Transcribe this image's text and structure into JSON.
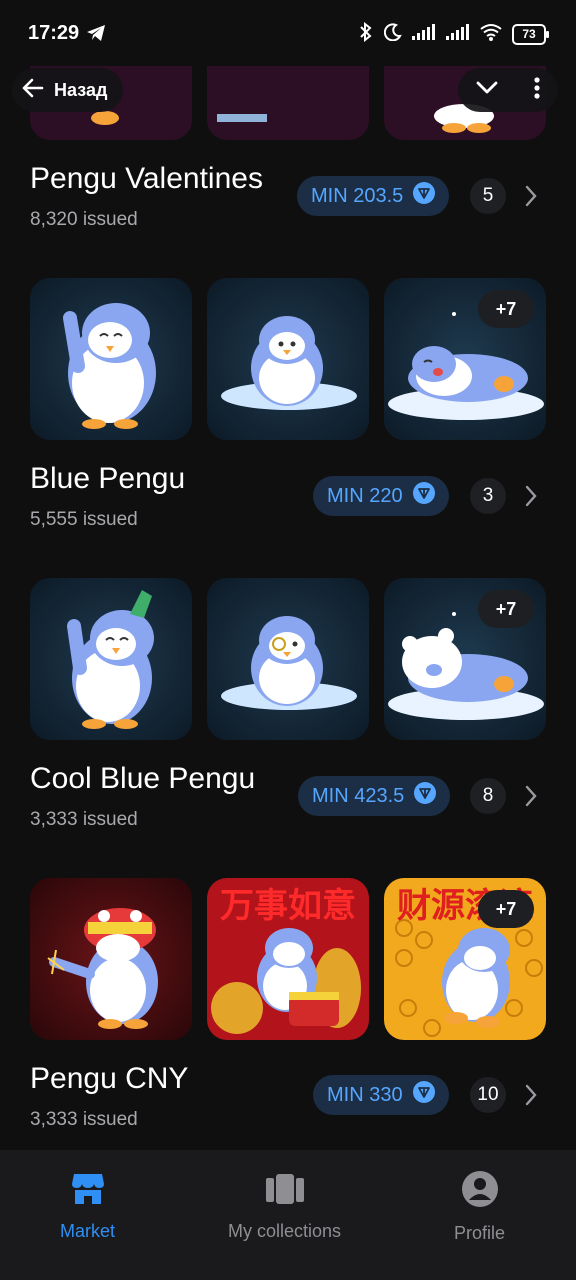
{
  "status_bar": {
    "time": "17:29",
    "battery": "73"
  },
  "header": {
    "back_label": "Назад"
  },
  "collections": [
    {
      "name": "Pengu Valentines",
      "issued": "8,320 issued",
      "min": "MIN 203.5",
      "count": "5"
    },
    {
      "name": "Blue Pengu",
      "issued": "5,555 issued",
      "min": "MIN 220",
      "count": "3",
      "more": "+7"
    },
    {
      "name": "Cool Blue Pengu",
      "issued": "3,333 issued",
      "min": "MIN 423.5",
      "count": "8",
      "more": "+7"
    },
    {
      "name": "Pengu CNY",
      "issued": "3,333 issued",
      "min": "MIN 330",
      "count": "10",
      "more": "+7",
      "banner_left": "万事如意",
      "banner_right": "财源滚滚"
    }
  ],
  "nav": {
    "market": "Market",
    "collections": "My collections",
    "profile": "Profile"
  },
  "colors": {
    "accent": "#2f8ff5",
    "pill_bg": "#1b2e46",
    "pill_text": "#56a6ff"
  }
}
